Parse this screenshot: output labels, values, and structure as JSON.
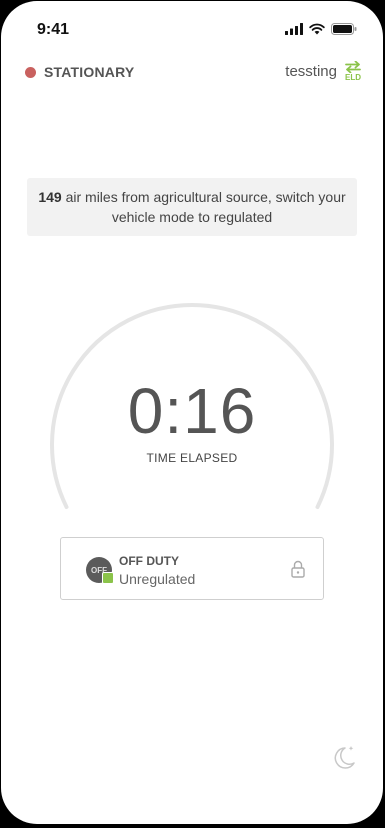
{
  "status_bar": {
    "time": "9:41"
  },
  "header": {
    "vehicle_status": "STATIONARY",
    "username": "tessting",
    "eld_label": "ELD"
  },
  "notice": {
    "miles": "149",
    "message": " air miles from agricultural source, switch your vehicle mode to regulated"
  },
  "timer": {
    "elapsed": "0:16",
    "label": "TIME ELAPSED"
  },
  "duty": {
    "badge": "OFF",
    "status": "OFF DUTY",
    "mode": "Unregulated"
  },
  "colors": {
    "stationary_dot": "#c9615f",
    "eld_accent": "#8bc34a"
  },
  "icons": [
    "signal-icon",
    "wifi-icon",
    "battery-icon",
    "eld-switch-icon",
    "lock-icon",
    "moon-icon"
  ]
}
